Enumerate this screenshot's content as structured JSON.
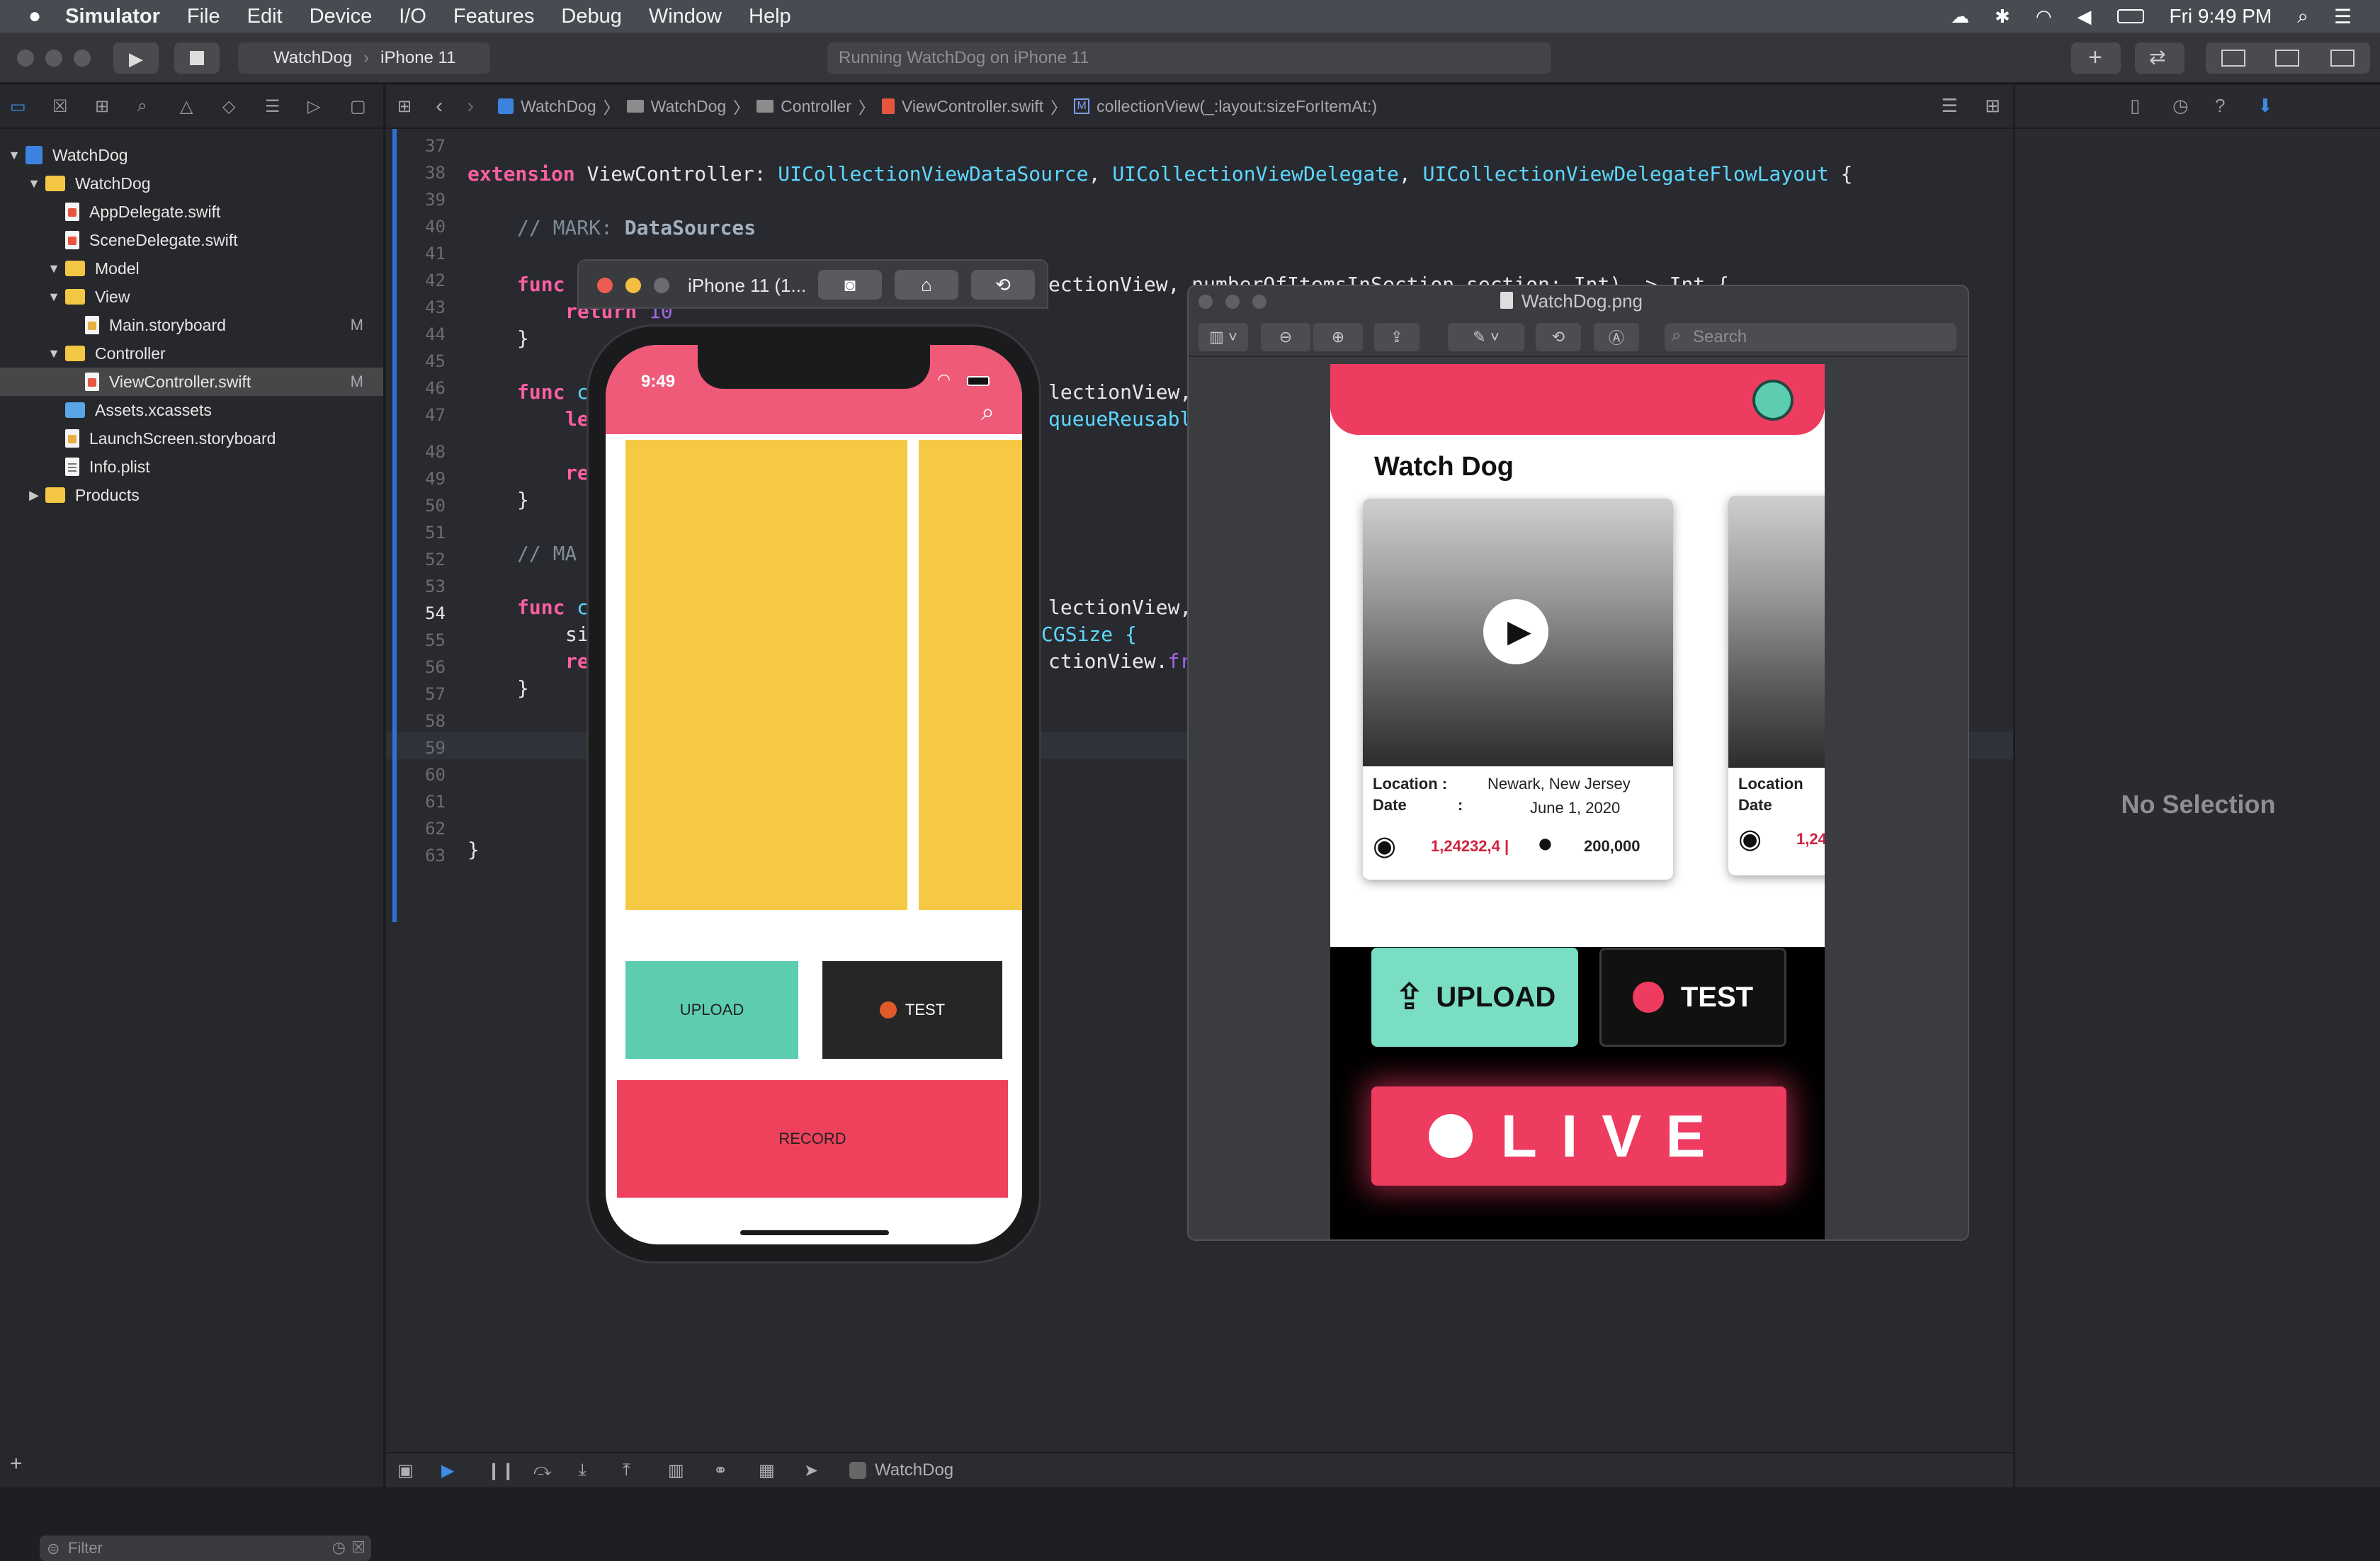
{
  "menubar": {
    "app_name": "Simulator",
    "items": [
      "File",
      "Edit",
      "Device",
      "I/O",
      "Features",
      "Debug",
      "Window",
      "Help"
    ],
    "clock": "Fri 9:49 PM"
  },
  "toolbar": {
    "scheme": "WatchDog",
    "device": "iPhone 11",
    "status": "Running WatchDog on iPhone 11"
  },
  "navigator": {
    "items": [
      {
        "label": "WatchDog",
        "kind": "project",
        "level": 0
      },
      {
        "label": "WatchDog",
        "kind": "folder",
        "level": 1
      },
      {
        "label": "AppDelegate.swift",
        "kind": "swift",
        "level": 2
      },
      {
        "label": "SceneDelegate.swift",
        "kind": "swift",
        "level": 2
      },
      {
        "label": "Model",
        "kind": "folder",
        "level": 2
      },
      {
        "label": "View",
        "kind": "folder",
        "level": 2
      },
      {
        "label": "Main.storyboard",
        "kind": "storyboard",
        "level": 3,
        "mark": "M"
      },
      {
        "label": "Controller",
        "kind": "folder",
        "level": 2
      },
      {
        "label": "ViewController.swift",
        "kind": "swift",
        "level": 3,
        "mark": "M",
        "selected": true
      },
      {
        "label": "Assets.xcassets",
        "kind": "assets",
        "level": 2
      },
      {
        "label": "LaunchScreen.storyboard",
        "kind": "storyboard",
        "level": 2
      },
      {
        "label": "Info.plist",
        "kind": "plist",
        "level": 2
      },
      {
        "label": "Products",
        "kind": "folder",
        "level": 1
      }
    ],
    "filter_placeholder": "Filter"
  },
  "jumpbar": {
    "crumbs": [
      "WatchDog",
      "WatchDog",
      "Controller",
      "ViewController.swift",
      "collectionView(_:layout:sizeForItemAt:)"
    ]
  },
  "editor": {
    "line_numbers": [
      "37",
      "38",
      "39",
      "40",
      "41",
      "42",
      "43",
      "44",
      "45",
      "46",
      "47",
      "48",
      "49",
      "50",
      "51",
      "52",
      "53",
      "54",
      "55",
      "56",
      "57",
      "58",
      "59",
      "60",
      "61",
      "62",
      "63"
    ],
    "current_line": "54",
    "code": {
      "l38_kw": "extension",
      "l38_a": " ViewController: ",
      "l38_t1": "UICollectionViewDataSource",
      "l38_t2": "UICollectionViewDelegate",
      "l38_t3": "UICollectionViewDelegateFlowLayout",
      "l38_end": " {",
      "l40_cm": "// MARK: ",
      "l40_cmb": "DataSources",
      "func": "func",
      "l42_tail": "ectionView, numberOfItemsInSection section: Int) -> Int {",
      "l43_kw": "return",
      "l43_num": " 10",
      "brace": "}",
      "l46_a": " c",
      "l46_tail": "lectionView,",
      "l47_a": "le",
      "l47_tail": "queueReusable",
      "l48_a": "re",
      "l51_a": "// MA",
      "l53_a": " c",
      "l53_tail": "lectionView,",
      "l54_a": "si",
      "l54_tail": "CGSize {",
      "l55_a": "re",
      "l55_tail": "ctionView.",
      "l55_fr": "fr"
    }
  },
  "inspector": {
    "no_selection": "No Selection"
  },
  "debugbar": {
    "target": "WatchDog"
  },
  "simulator": {
    "title": "iPhone 11 (1...",
    "time": "9:49",
    "upload_label": "UPLOAD",
    "test_label": "TEST",
    "record_label": "RECORD",
    "colors": {
      "header": "#ee5a78",
      "card": "#f6c945",
      "upload": "#5ccdb0",
      "test": "#262626",
      "record": "#ee425c"
    }
  },
  "preview": {
    "title": "WatchDog.png",
    "search_placeholder": "Search",
    "image": {
      "title": "Watch Dog",
      "card1": {
        "location_label": "Location :",
        "location_value": "Newark, New Jersey",
        "date_label": "Date",
        "date_colon": ":",
        "date_value": "June 1, 2020",
        "views": "1,24232,4 |",
        "comments": "200,000"
      },
      "card2": {
        "location_label": "Location",
        "date_label": "Date",
        "views": "1,24"
      },
      "upload_label": "UPLOAD",
      "test_label": "TEST",
      "live_label": "LIVE"
    }
  }
}
